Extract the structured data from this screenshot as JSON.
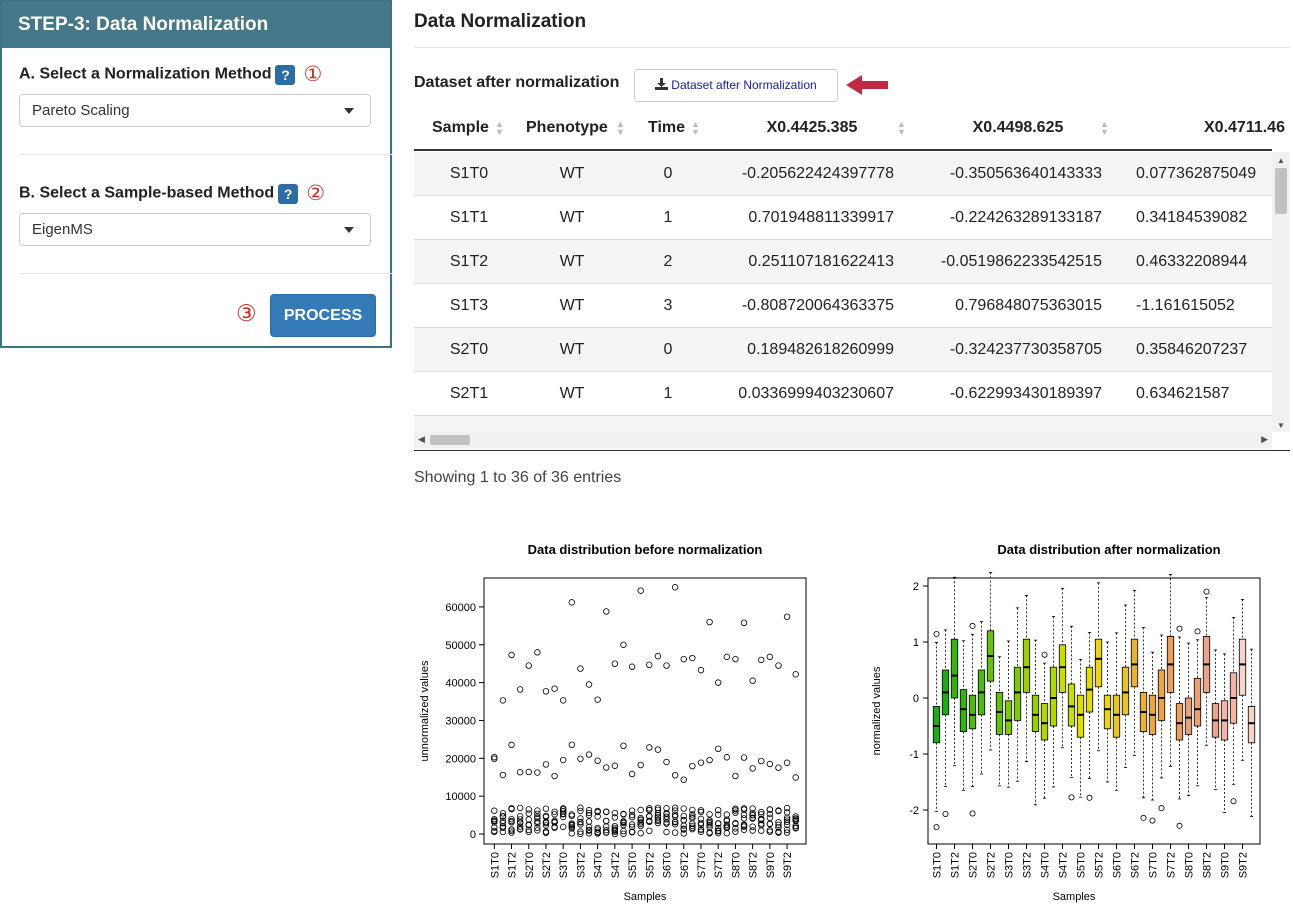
{
  "sidebar": {
    "header": "STEP-3: Data Normalization",
    "norm_label": "A. Select a Normalization Method",
    "norm_help": "?",
    "norm_step": "①",
    "norm_value": "Pareto Scaling",
    "sample_label": "B. Select a Sample-based Method",
    "sample_help": "?",
    "sample_step": "②",
    "sample_value": "EigenMS",
    "process_step": "③",
    "process_label": "PROCESS"
  },
  "main": {
    "title": "Data Normalization",
    "dataset_label": "Dataset after normalization",
    "download_label": "Dataset after Normalization",
    "showing": "Showing 1 to 36 of 36 entries"
  },
  "table": {
    "headers": [
      "Sample",
      "Phenotype",
      "Time",
      "X0.4425.385",
      "X0.4498.625",
      "X0.4711.46"
    ],
    "rows": [
      [
        "S1T0",
        "WT",
        "0",
        "-0.205622424397778",
        "-0.350563640143333",
        "0.077362875049"
      ],
      [
        "S1T1",
        "WT",
        "1",
        "0.701948811339917",
        "-0.224263289133187",
        "0.34184539082"
      ],
      [
        "S1T2",
        "WT",
        "2",
        "0.251107181622413",
        "-0.0519862233542515",
        "0.46332208944"
      ],
      [
        "S1T3",
        "WT",
        "3",
        "-0.808720064363375",
        "0.796848075363015",
        "-1.161615052"
      ],
      [
        "S2T0",
        "WT",
        "0",
        "0.189482618260999",
        "-0.324237730358705",
        "0.35846207237"
      ],
      [
        "S2T1",
        "WT",
        "1",
        "0.0336999403230607",
        "-0.622993430189397",
        "0.634621587"
      ]
    ]
  },
  "chart_data": [
    {
      "type": "scatter",
      "title": "Data distribution before normalization",
      "xlabel": "Samples",
      "ylabel": "unnormalized values",
      "ylim": [
        0,
        65000
      ],
      "yticks": [
        "0",
        "10000",
        "20000",
        "30000",
        "40000",
        "50000",
        "60000"
      ],
      "categories": [
        "S1T0",
        "S1T2",
        "S2T0",
        "S2T2",
        "S3T0",
        "S3T2",
        "S4T0",
        "S4T2",
        "S5T0",
        "S5T2",
        "S6T0",
        "S6T2",
        "S7T0",
        "S7T2",
        "S8T0",
        "S8T2",
        "S9T0",
        "S9T2"
      ],
      "outlier_top": [
        20300,
        35300,
        47300,
        38200,
        44500,
        48000,
        37700,
        38400,
        35300,
        61200,
        43700,
        39500,
        35500,
        58800,
        45000,
        50000,
        44200,
        64300,
        44700,
        47000,
        44500,
        65200,
        46200,
        46500,
        43300,
        56000,
        40000,
        46800,
        46200,
        55800,
        40500,
        46000,
        46800,
        44500,
        57400,
        42200
      ]
    },
    {
      "type": "box",
      "title": "Data distribution after normalization",
      "xlabel": "Samples",
      "ylabel": "normalized values",
      "ylim": [
        -2.5,
        2
      ],
      "yticks": [
        "-2",
        "-1",
        "0",
        "1",
        "2"
      ],
      "categories": [
        "S1T0",
        "S1T2",
        "S2T0",
        "S2T2",
        "S3T0",
        "S3T2",
        "S4T0",
        "S4T2",
        "S5T0",
        "S5T2",
        "S6T0",
        "S6T2",
        "S7T0",
        "S7T2",
        "S8T0",
        "S8T2",
        "S9T0",
        "S9T2"
      ],
      "medians": [
        -0.5,
        0.1,
        0.4,
        -0.2,
        -0.3,
        0.1,
        0.75,
        -0.25,
        -0.4,
        0.1,
        0.55,
        -0.3,
        -0.45,
        0.0,
        0.55,
        -0.15,
        -0.3,
        0.15,
        0.7,
        -0.2,
        -0.3,
        0.1,
        0.6,
        -0.25,
        -0.3,
        0.0,
        0.6,
        -0.45,
        -0.35,
        -0.2,
        0.6,
        -0.4,
        -0.4,
        0.0,
        0.6,
        -0.45
      ],
      "q1": [
        -0.8,
        -0.3,
        0.0,
        -0.6,
        -0.55,
        -0.3,
        0.3,
        -0.65,
        -0.65,
        -0.4,
        0.1,
        -0.6,
        -0.75,
        -0.5,
        0.1,
        -0.5,
        -0.7,
        -0.25,
        0.2,
        -0.55,
        -0.7,
        -0.3,
        0.2,
        -0.6,
        -0.65,
        -0.4,
        0.1,
        -0.75,
        -0.65,
        -0.5,
        0.1,
        -0.7,
        -0.75,
        -0.45,
        0.05,
        -0.8
      ],
      "q3": [
        -0.15,
        0.5,
        1.05,
        0.15,
        0.05,
        0.5,
        1.2,
        0.1,
        -0.05,
        0.55,
        1.05,
        0.05,
        -0.1,
        0.55,
        0.95,
        0.25,
        0.05,
        0.55,
        1.05,
        0.05,
        0.05,
        0.55,
        1.05,
        0.1,
        0.05,
        0.5,
        1.1,
        -0.1,
        0.0,
        0.35,
        1.1,
        -0.1,
        -0.05,
        0.45,
        1.05,
        -0.15
      ]
    }
  ]
}
